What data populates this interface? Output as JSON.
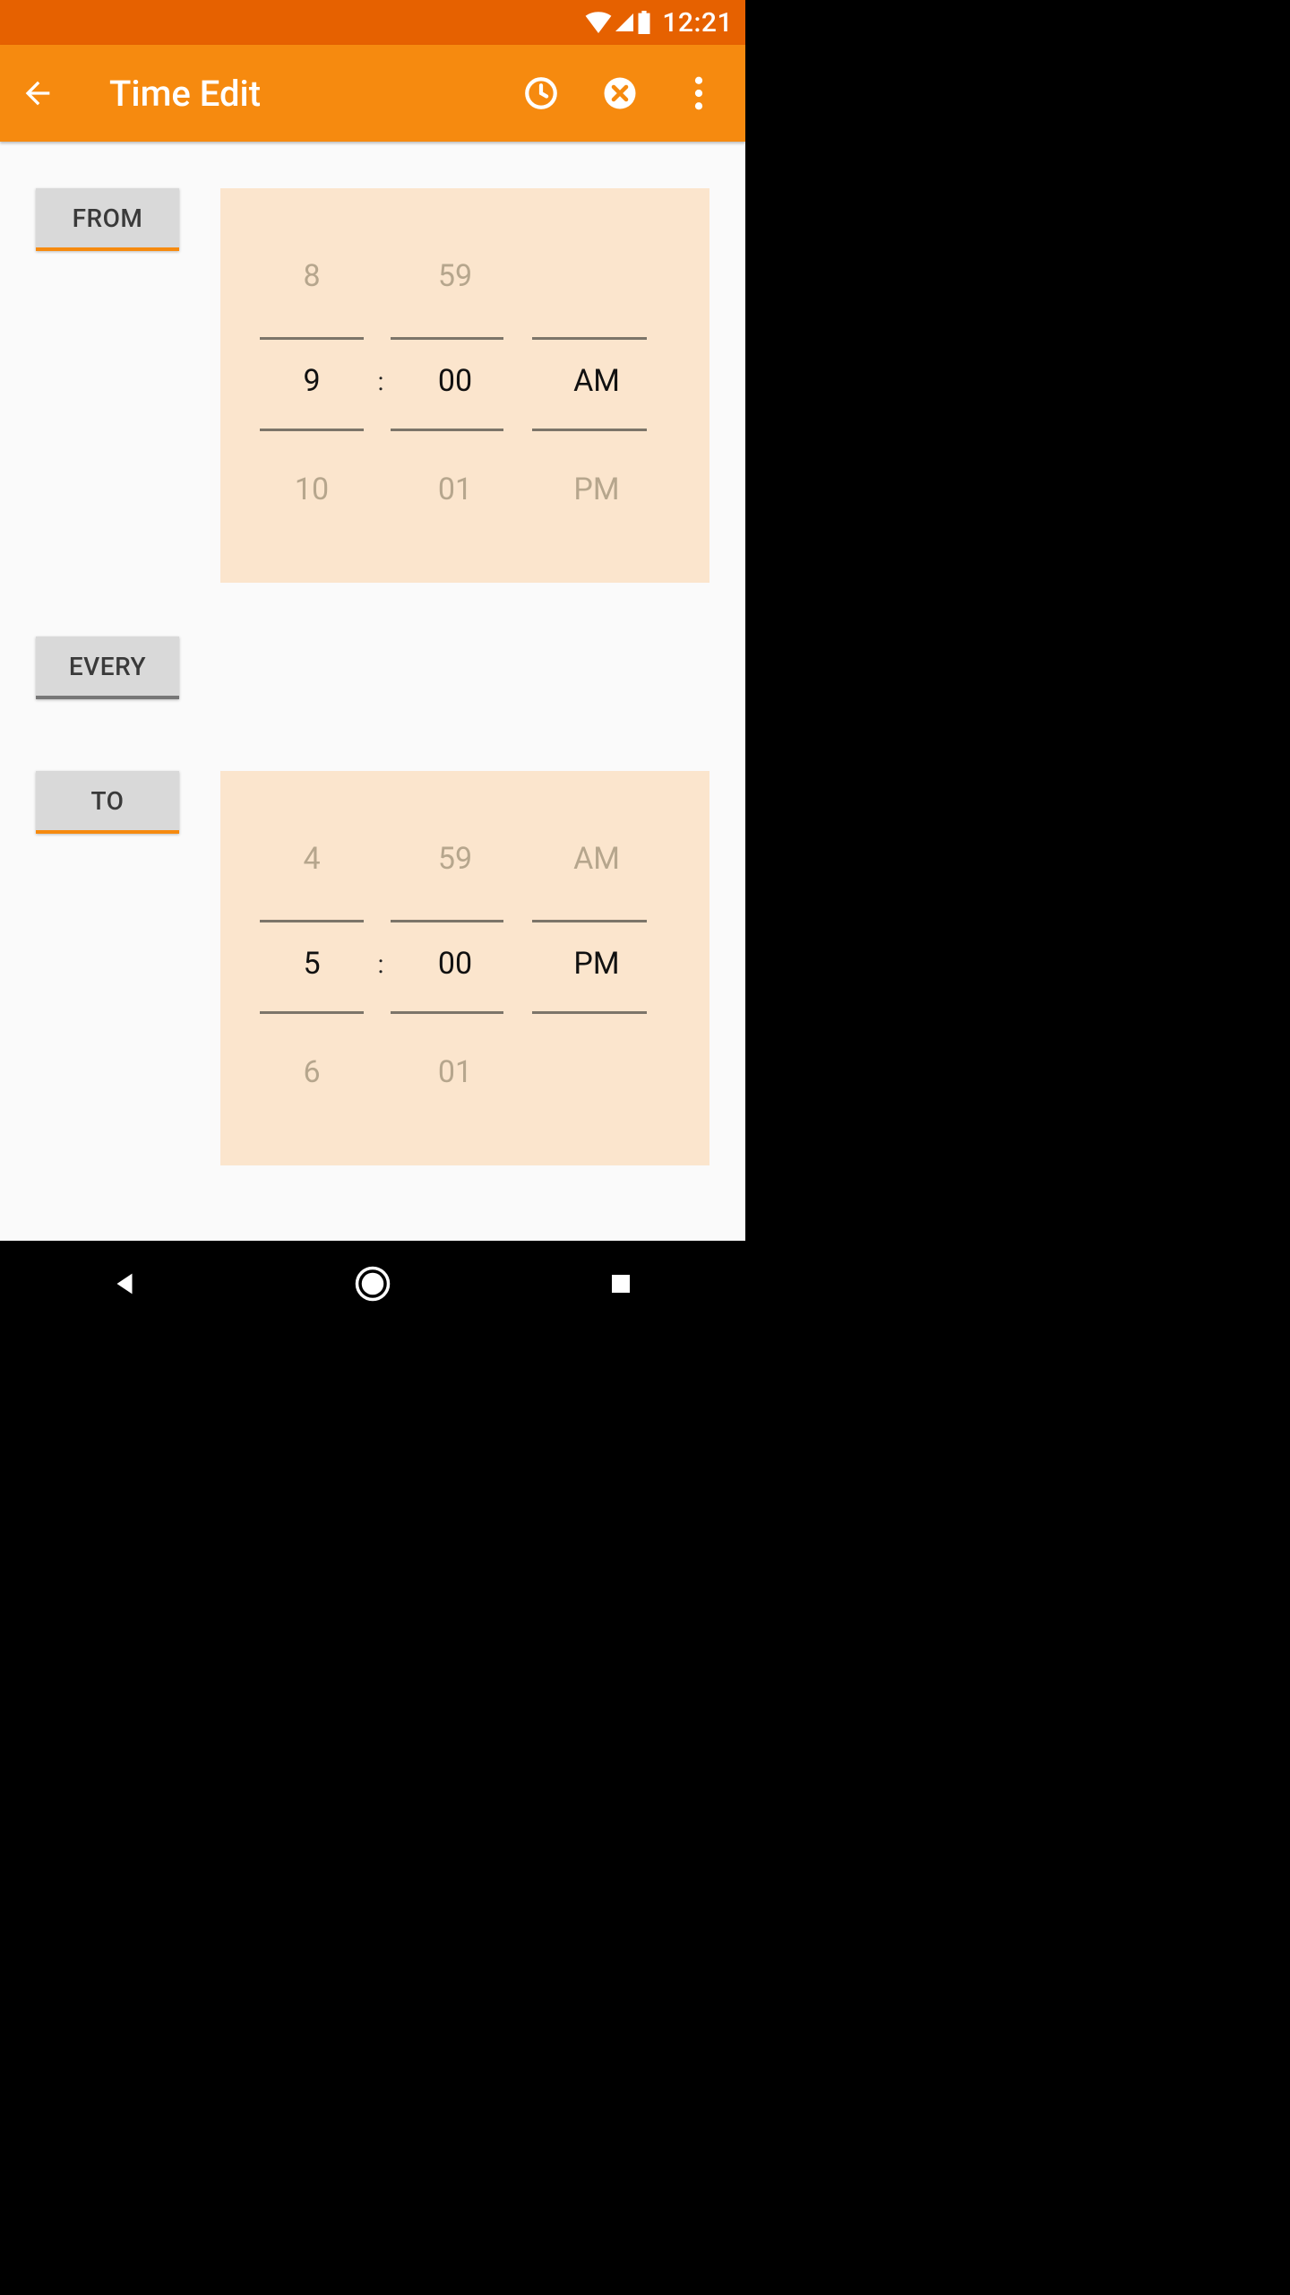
{
  "status": {
    "time": "12:21"
  },
  "appbar": {
    "title": "Time Edit"
  },
  "labels": {
    "from": "FROM",
    "every": "EVERY",
    "to": "TO"
  },
  "from": {
    "hour_prev": "8",
    "hour": "9",
    "hour_next": "10",
    "min_prev": "59",
    "min": "00",
    "min_next": "01",
    "ampm_prev": "",
    "ampm": "AM",
    "ampm_next": "PM",
    "colon": ":"
  },
  "to": {
    "hour_prev": "4",
    "hour": "5",
    "hour_next": "6",
    "min_prev": "59",
    "min": "00",
    "min_next": "01",
    "ampm_prev": "AM",
    "ampm": "PM",
    "ampm_next": "",
    "colon": ":"
  }
}
